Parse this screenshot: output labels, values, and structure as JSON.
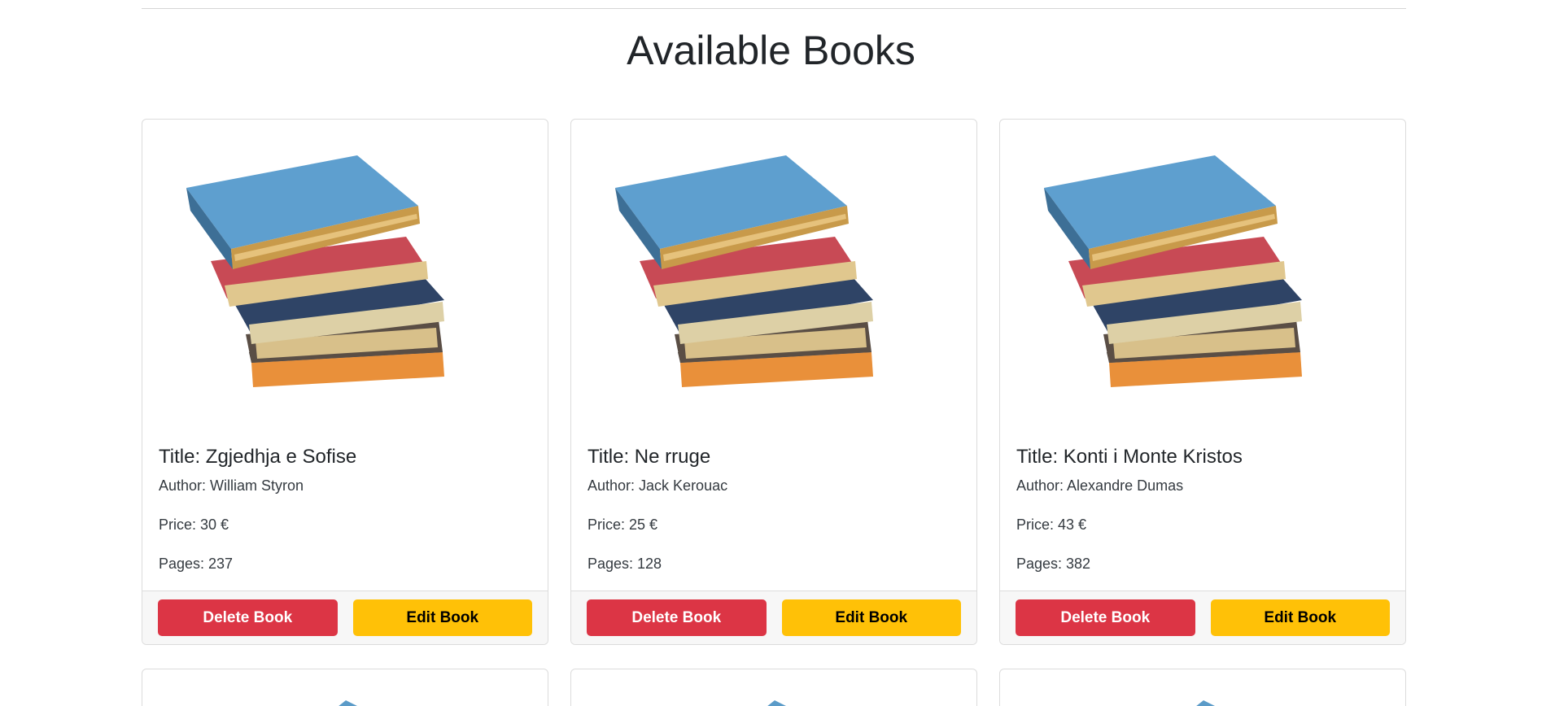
{
  "page": {
    "heading": "Available Books"
  },
  "colors": {
    "delete": "#dc3545",
    "edit": "#ffc107",
    "card_border": "#dcdcdc",
    "footer_bg": "#f7f7f7"
  },
  "cards": [
    {
      "title": "Title: Zgjedhja e Sofise",
      "author": "Author: William Styron",
      "price": "Price: 30 €",
      "pages": "Pages: 237",
      "delete_label": "Delete Book",
      "edit_label": "Edit Book"
    },
    {
      "title": "Title: Ne rruge",
      "author": "Author: Jack Kerouac",
      "price": "Price: 25 €",
      "pages": "Pages: 128",
      "delete_label": "Delete Book",
      "edit_label": "Edit Book"
    },
    {
      "title": "Title: Konti i Monte Kristos",
      "author": "Author: Alexandre Dumas",
      "price": "Price: 43 €",
      "pages": "Pages: 382",
      "delete_label": "Delete Book",
      "edit_label": "Edit Book"
    }
  ],
  "icons": {
    "book_image": "book-stack-icon"
  }
}
